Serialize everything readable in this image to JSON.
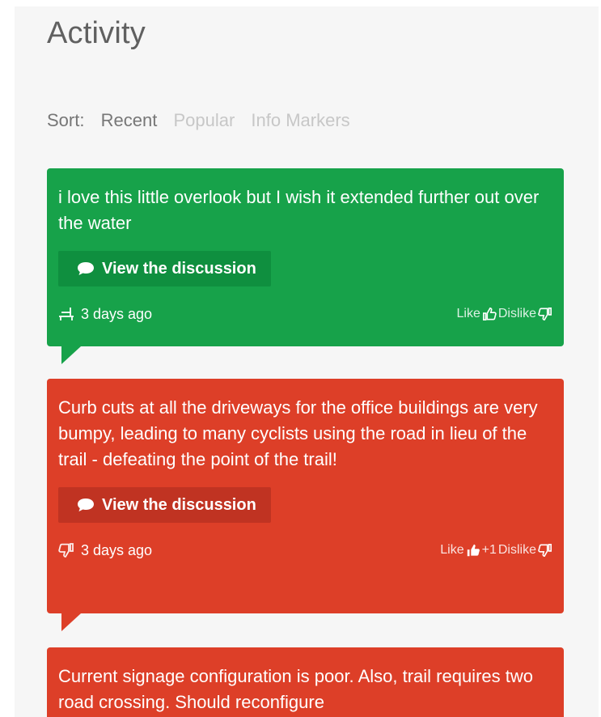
{
  "header": {
    "title": "Activity"
  },
  "sort": {
    "label": "Sort:",
    "options": [
      "Recent",
      "Popular",
      "Info Markers"
    ],
    "active": "Recent"
  },
  "cards": [
    {
      "color": "#17a24a",
      "text": "i love this little overlook but I wish it extended further out over the water",
      "button": "View the discussion",
      "category_icon": "bench-icon",
      "time": "3 days ago",
      "like_label": "Like",
      "like_count": "",
      "dislike_label": "Dislike"
    },
    {
      "color": "#dd3f28",
      "text": "Curb cuts at all the driveways for the office buildings are very bumpy, leading to many cyclists using the road in lieu of the trail - defeating the point of the trail!",
      "button": "View the discussion",
      "category_icon": "thumbs-down-icon",
      "time": "3 days ago",
      "like_label": "Like",
      "like_count": "+1",
      "dislike_label": "Dislike"
    },
    {
      "color": "#dd3f28",
      "text": "Current signage configuration is poor. Also, trail requires two road crossing. Should reconfigure"
    }
  ]
}
